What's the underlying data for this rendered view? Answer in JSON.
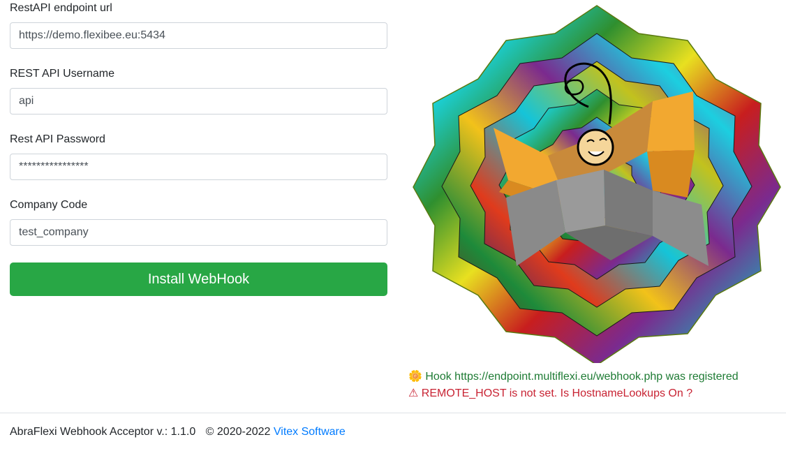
{
  "form": {
    "endpoint_label": "RestAPI endpoint url",
    "endpoint_value": "https://demo.flexibee.eu:5434",
    "username_label": "REST API Username",
    "username_value": "api",
    "password_label": "Rest API Password",
    "password_value": "****************",
    "company_label": "Company Code",
    "company_value": "test_company",
    "install_label": "Install WebHook"
  },
  "status": {
    "registered_icon": "flower-icon",
    "registered_glyph": "🌼",
    "registered_text": "Hook https://endpoint.multiflexi.eu/webhook.php was registered",
    "warning_icon": "warning-icon",
    "warning_glyph": "⚠",
    "warning_text": "REMOTE_HOST is not set. Is HostnameLookups On ?"
  },
  "footer": {
    "app_name": "AbraFlexi Webhook Acceptor v.: 1.1.0",
    "copyright": "© 2020-2022",
    "vendor_link": "Vitex Software"
  },
  "colors": {
    "success": "#28a745",
    "success_text": "#1e7b34",
    "danger_text": "#c82333",
    "link": "#007bff"
  },
  "logo": {
    "icon": "spiderweb-logo-icon"
  }
}
